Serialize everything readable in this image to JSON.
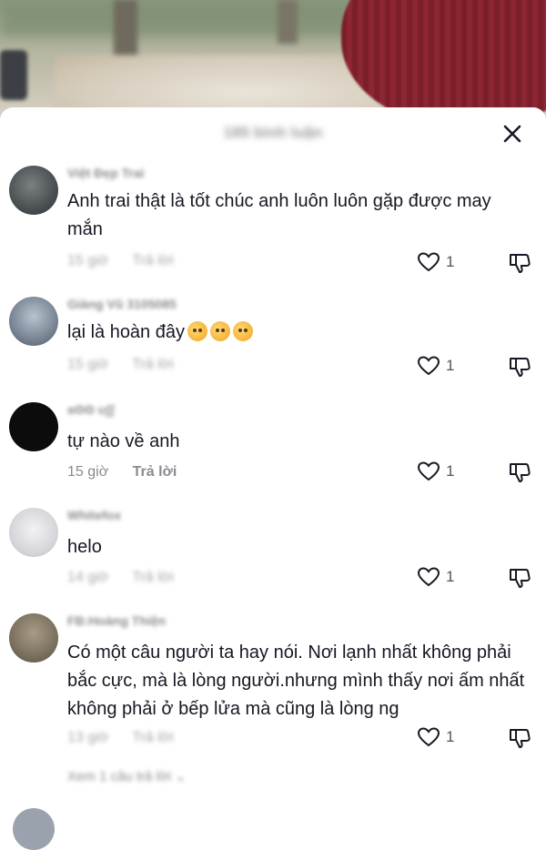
{
  "sheet": {
    "title": "185 bình luận"
  },
  "comments": [
    {
      "username": "Việt Đẹp Trai",
      "text": "Anh trai thật là tốt chúc anh luôn luôn gặp được may mắn",
      "time": "15 giờ",
      "reply": "Trả lời",
      "likes": "1",
      "avatar_color": "#555a5c"
    },
    {
      "username": "Giàng Vũ 3105085",
      "text": "lại là hoàn đây",
      "time": "15 giờ",
      "reply": "Trả lời",
      "likes": "1",
      "avatar_color": "#6c7b8b",
      "emojis": [
        "smiling-face-with-hearts",
        "smiling-face-with-hearts",
        "smiling-face-with-hearts"
      ]
    },
    {
      "username": "ɞʘʘ ʊʃʃ",
      "text": "tự nào về anh",
      "time": "15 giờ",
      "reply": "Trả lời",
      "likes": "1",
      "avatar_color": "#0c0c0c"
    },
    {
      "username": "Whitefox",
      "text": "helo",
      "time": "14 giờ",
      "reply": "Trả lời",
      "likes": "1",
      "avatar_color": "#d9d9dc"
    },
    {
      "username": "FB:Hoàng Thiện",
      "text": "Có một câu người ta hay nói. Nơi lạnh nhất không phải bắc cực, mà là lòng người.nhưng mình thấy nơi ấm nhất không phải ở bếp lửa mà cũng là lòng ng",
      "time": "13 giờ",
      "reply": "Trả lời",
      "likes": "1",
      "avatar_color": "#7f7462",
      "more_replies": "Xem 1 câu trả lời"
    }
  ],
  "colors": {
    "text_primary": "#161823",
    "text_secondary": "#8a8b91"
  }
}
